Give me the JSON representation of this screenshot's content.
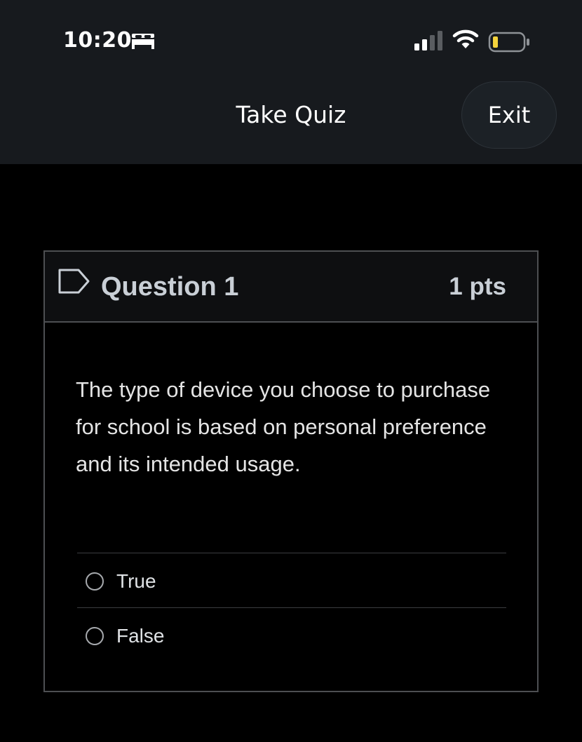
{
  "status_bar": {
    "time": "10:20",
    "icons": [
      "bed-icon",
      "signal-icon",
      "wifi-icon",
      "battery-icon"
    ]
  },
  "header": {
    "title": "Take Quiz",
    "exit_label": "Exit"
  },
  "question": {
    "flag_icon": "flag-icon",
    "title": "Question 1",
    "points": "1 pts",
    "text": "The type of device you choose to purchase for school is based on personal preference and its intended usage.",
    "answers": [
      {
        "label": "True",
        "selected": false
      },
      {
        "label": "False",
        "selected": false
      }
    ]
  },
  "colors": {
    "background": "#000000",
    "topbar": "#171a1e",
    "card_border": "#4d4f52",
    "header_text": "#c9cfd6",
    "battery_fill": "#f5d33c"
  }
}
